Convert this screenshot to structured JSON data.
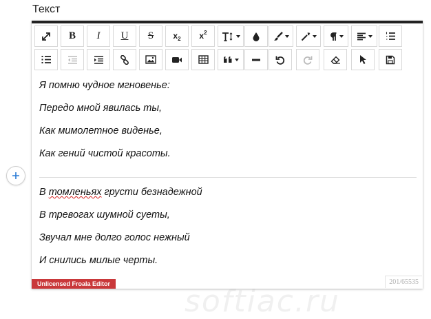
{
  "field": {
    "label": "Текст"
  },
  "toolbar": {
    "row1": [
      {
        "name": "fullscreen-button",
        "icon": "expand-icon",
        "text": "",
        "disabled": false
      },
      {
        "name": "bold-button",
        "icon": "bold-icon",
        "text": "B",
        "disabled": false
      },
      {
        "name": "italic-button",
        "icon": "italic-icon",
        "text": "I",
        "disabled": false
      },
      {
        "name": "underline-button",
        "icon": "underline-icon",
        "text": "U",
        "disabled": false
      },
      {
        "name": "strikethrough-button",
        "icon": "strikethrough-icon",
        "text": "S",
        "disabled": false
      },
      {
        "name": "subscript-button",
        "icon": "subscript-icon",
        "text": "x",
        "sub": "2",
        "disabled": false
      },
      {
        "name": "superscript-button",
        "icon": "superscript-icon",
        "text": "x",
        "sup": "2",
        "disabled": false
      },
      {
        "name": "font-size-button",
        "icon": "text-height-icon",
        "text": "",
        "disabled": false,
        "dropdown": true
      },
      {
        "name": "text-color-button",
        "icon": "droplet-icon",
        "text": "",
        "disabled": false
      },
      {
        "name": "paragraph-style-button",
        "icon": "paintbrush-icon",
        "text": "",
        "disabled": false,
        "dropdown": true
      },
      {
        "name": "inline-style-button",
        "icon": "magic-wand-icon",
        "text": "",
        "disabled": false,
        "dropdown": true
      },
      {
        "name": "paragraph-format-button",
        "icon": "pilcrow-icon",
        "text": "",
        "disabled": false,
        "dropdown": true
      },
      {
        "name": "align-button",
        "icon": "align-left-icon",
        "text": "",
        "disabled": false,
        "dropdown": true
      },
      {
        "name": "ordered-list-button",
        "icon": "ordered-list-icon",
        "text": "",
        "disabled": false
      }
    ],
    "row2": [
      {
        "name": "unordered-list-button",
        "icon": "unordered-list-icon",
        "text": "",
        "disabled": false
      },
      {
        "name": "outdent-button",
        "icon": "outdent-icon",
        "text": "",
        "disabled": true
      },
      {
        "name": "indent-button",
        "icon": "indent-icon",
        "text": "",
        "disabled": false
      },
      {
        "name": "insert-link-button",
        "icon": "link-icon",
        "text": "",
        "disabled": false
      },
      {
        "name": "insert-image-button",
        "icon": "image-icon",
        "text": "",
        "disabled": false
      },
      {
        "name": "insert-video-button",
        "icon": "video-camera-icon",
        "text": "",
        "disabled": false
      },
      {
        "name": "insert-table-button",
        "icon": "table-icon",
        "text": "",
        "disabled": false
      },
      {
        "name": "quote-button",
        "icon": "quote-icon",
        "text": "",
        "disabled": false,
        "dropdown": true
      },
      {
        "name": "horizontal-line-button",
        "icon": "horizontal-rule-icon",
        "text": "",
        "disabled": false
      },
      {
        "name": "undo-button",
        "icon": "undo-icon",
        "text": "",
        "disabled": false
      },
      {
        "name": "redo-button",
        "icon": "redo-icon",
        "text": "",
        "disabled": true
      },
      {
        "name": "clear-formatting-button",
        "icon": "eraser-icon",
        "text": "",
        "disabled": false
      },
      {
        "name": "select-all-button",
        "icon": "cursor-arrow-icon",
        "text": "",
        "disabled": false
      },
      {
        "name": "save-button",
        "icon": "floppy-disk-icon",
        "text": "",
        "disabled": false
      }
    ]
  },
  "content": {
    "stanza1": [
      "Я помню чудное мгновенье:",
      "Передо мной явилась ты,",
      "Как мимолетное виденье,",
      "Как гений чистой красоты."
    ],
    "stanza2": [
      "В томленьях грусти безнадежной",
      "В тревогах шумной суеты,",
      "Звучал мне долго голос нежный",
      "И снились милые черты."
    ],
    "misspelled_word": "томленьях"
  },
  "footer": {
    "license_badge": "Unlicensed Froala Editor",
    "char_counter": "201/65535"
  },
  "watermark": "softiac.ru",
  "colors": {
    "toolbar_border": "#222222",
    "badge_bg": "#c9383a",
    "plus_icon": "#2a7bd6"
  }
}
